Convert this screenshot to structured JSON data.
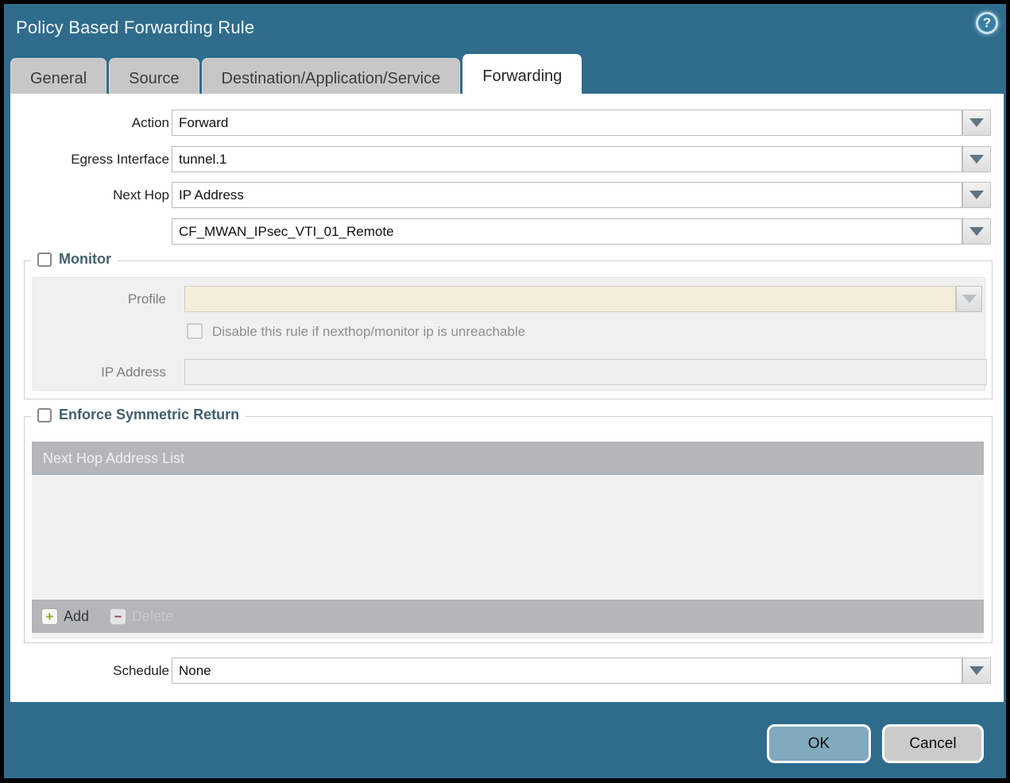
{
  "dialog": {
    "title": "Policy Based Forwarding Rule",
    "help_icon": "?",
    "tabs": [
      {
        "label": "General",
        "active": false
      },
      {
        "label": "Source",
        "active": false
      },
      {
        "label": "Destination/Application/Service",
        "active": false
      },
      {
        "label": "Forwarding",
        "active": true
      }
    ]
  },
  "form": {
    "action": {
      "label": "Action",
      "value": "Forward"
    },
    "egress_interface": {
      "label": "Egress Interface",
      "value": "tunnel.1"
    },
    "next_hop": {
      "label": "Next Hop",
      "value": "IP Address"
    },
    "next_hop_address": {
      "value": "CF_MWAN_IPsec_VTI_01_Remote"
    },
    "monitor": {
      "label": "Monitor",
      "checked": false,
      "profile": {
        "label": "Profile",
        "value": ""
      },
      "disable_rule": {
        "label": "Disable this rule if nexthop/monitor ip is unreachable",
        "checked": false
      },
      "ip_address": {
        "label": "IP Address",
        "value": ""
      }
    },
    "enforce_symmetric_return": {
      "label": "Enforce Symmetric Return",
      "checked": false,
      "table": {
        "header": "Next Hop Address List",
        "rows": []
      },
      "add_label": "Add",
      "delete_label": "Delete"
    },
    "schedule": {
      "label": "Schedule",
      "value": "None"
    }
  },
  "footer": {
    "ok_label": "OK",
    "cancel_label": "Cancel"
  },
  "colors": {
    "titlebar_teal": "#2f6c8c",
    "tab_inactive": "#c7c7c7",
    "tab_active": "#ffffff",
    "disabled_field_beige": "#f3edda",
    "table_header_gray": "#b3b7ba",
    "ok_button": "#7fa9bc",
    "cancel_button": "#cbcbcb",
    "add_plus_green": "#96a437",
    "delete_minus_red": "#9c4a4a"
  }
}
